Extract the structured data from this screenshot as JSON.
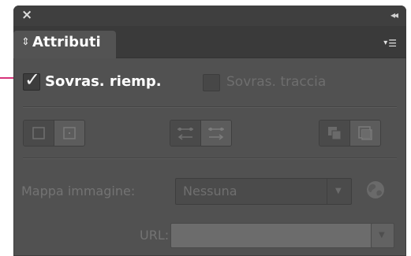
{
  "window": {
    "close_glyph": "×",
    "collapse_glyph": "◂◂"
  },
  "tab": {
    "arrows_glyph": "⇕",
    "label": "Attributi"
  },
  "panel_menu": {
    "caret": "▾",
    "icon": "☰"
  },
  "options": {
    "overprint_fill": {
      "label": "Sovras. riemp.",
      "checked": true,
      "check_glyph": "✓"
    },
    "overprint_stroke": {
      "label": "Sovras. traccia",
      "checked": false,
      "enabled": false
    }
  },
  "toolbar": {
    "groups": [
      {
        "name": "show-center",
        "buttons": [
          "hide-center-icon",
          "show-center-icon"
        ]
      },
      {
        "name": "reverse-path",
        "buttons": [
          "reverse-direction-off-icon",
          "reverse-direction-on-icon"
        ]
      },
      {
        "name": "fill-rule",
        "buttons": [
          "nonzero-winding-icon",
          "even-odd-icon"
        ]
      }
    ]
  },
  "image_map": {
    "label": "Mappa immagine:",
    "selected": "Nessuna",
    "dropdown_glyph": "▼",
    "browser_icon": "globe-icon"
  },
  "url": {
    "label": "URL:",
    "value": "",
    "dropdown_glyph": "▼"
  },
  "colors": {
    "panel_bg": "#515151",
    "titlebar_bg": "#3f3f3f",
    "callout": "#d6337a"
  }
}
